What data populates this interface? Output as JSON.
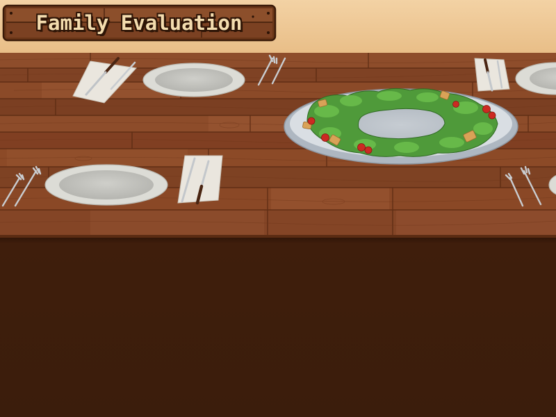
{
  "scene": {
    "title": "Family Evaluation",
    "colors": {
      "wall": "#ecc38c",
      "wall_upper": "#f3d2a4",
      "table_wood": "#8a4a26",
      "table_wood_dark": "#6a3318",
      "table_front": "#3a1c0c",
      "sign_wood": "#7a4424",
      "plate": "#d8d8d2",
      "salad_green": "#4f9a3a",
      "tomato": "#cc2a22"
    },
    "icons": [
      "plate-icon",
      "fork-icon",
      "knife-icon",
      "napkin-icon",
      "salad-platter-icon"
    ]
  }
}
